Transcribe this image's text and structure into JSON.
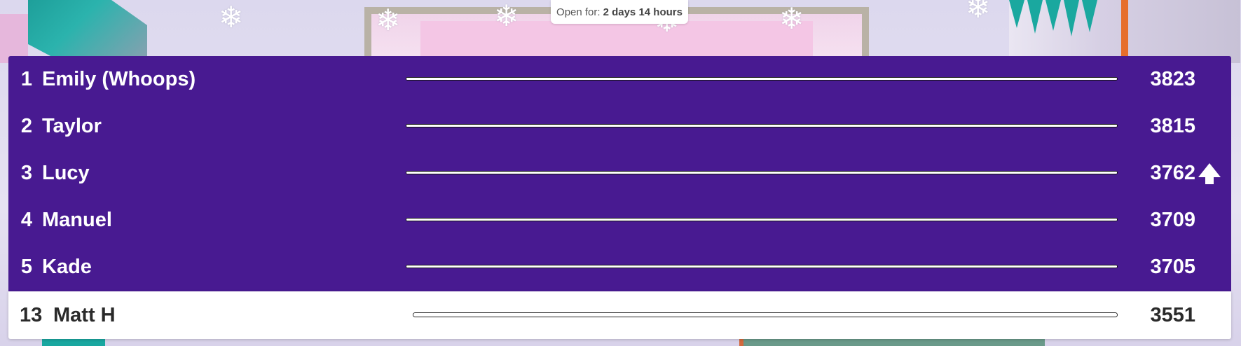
{
  "header": {
    "open_for_label": "Open for:",
    "open_for_value": "2 days 14 hours"
  },
  "leaderboard": {
    "rows": [
      {
        "rank": "1",
        "name": "Emily (Whoops)",
        "score": "3823",
        "progress": 1.0
      },
      {
        "rank": "2",
        "name": "Taylor",
        "score": "3815",
        "progress": 1.0
      },
      {
        "rank": "3",
        "name": "Lucy",
        "score": "3762",
        "progress": 1.0,
        "trend": "up"
      },
      {
        "rank": "4",
        "name": "Manuel",
        "score": "3709",
        "progress": 1.0
      },
      {
        "rank": "5",
        "name": "Kade",
        "score": "3705",
        "progress": 1.0
      }
    ],
    "current_user": {
      "rank": "13",
      "name": "Matt H",
      "score": "3551",
      "progress": 1.0
    }
  },
  "colors": {
    "board_purple": "#481a91",
    "text_light": "#ffffff",
    "text_dark": "#2a2a2a"
  },
  "icons": {
    "trend_up": "arrow-up-icon",
    "decor": "snowflake-icon"
  }
}
